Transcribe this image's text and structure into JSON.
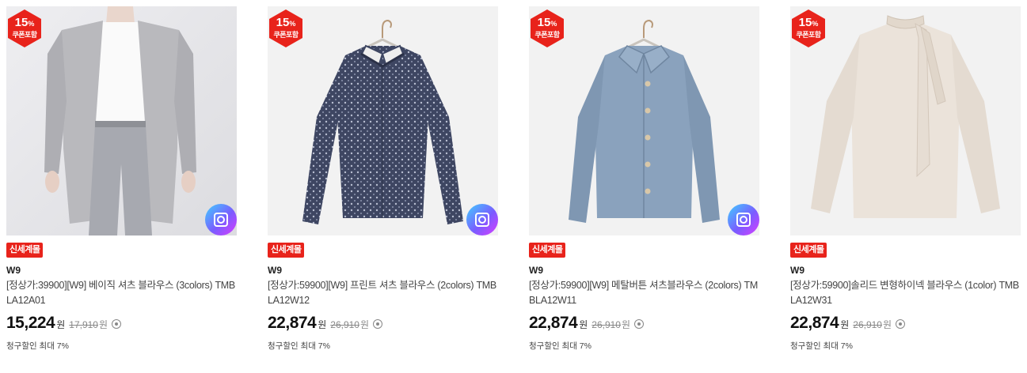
{
  "products": [
    {
      "badge_percent": "15",
      "badge_percent_sign": "%",
      "badge_caption": "쿠폰포함",
      "tag": "신세계몰",
      "brand": "W9",
      "title": "[정상가:39900][W9] 베이직 셔츠 블라우스 (3colors) TMBLA12A01",
      "price": "15,224",
      "currency": "원",
      "original_price": "17,910",
      "benefit": "청구할인 최대 7%",
      "has_camera": true,
      "image": "model-gray-cardigan"
    },
    {
      "badge_percent": "15",
      "badge_percent_sign": "%",
      "badge_caption": "쿠폰포함",
      "tag": "신세계몰",
      "brand": "W9",
      "title": "[정상가:59900][W9] 프린트 셔츠 블라우스 (2colors) TMBLA12W12",
      "price": "22,874",
      "currency": "원",
      "original_price": "26,910",
      "benefit": "청구할인 최대 7%",
      "has_camera": true,
      "image": "navy-print-shirt"
    },
    {
      "badge_percent": "15",
      "badge_percent_sign": "%",
      "badge_caption": "쿠폰포함",
      "tag": "신세계몰",
      "brand": "W9",
      "title": "[정상가:59900][W9] 메탈버튼 셔츠블라우스 (2colors) TMBLA12W11",
      "price": "22,874",
      "currency": "원",
      "original_price": "26,910",
      "benefit": "청구할인 최대 7%",
      "has_camera": true,
      "image": "blue-metal-button-shirt"
    },
    {
      "badge_percent": "15",
      "badge_percent_sign": "%",
      "badge_caption": "쿠폰포함",
      "tag": "신세계몰",
      "brand": "W9",
      "title": "[정상가:59900]솔리드 변형하이넥 블라우스 (1color) TMBLA12W31",
      "price": "22,874",
      "currency": "원",
      "original_price": "26,910",
      "benefit": "청구할인 최대 7%",
      "has_camera": false,
      "image": "beige-tie-neck-blouse"
    }
  ],
  "colors": {
    "badge_red": "#e8231b",
    "tag_red": "#e8231b",
    "camera_gradient": [
      "#3fd0ff",
      "#7a5cff",
      "#d93cff"
    ]
  }
}
